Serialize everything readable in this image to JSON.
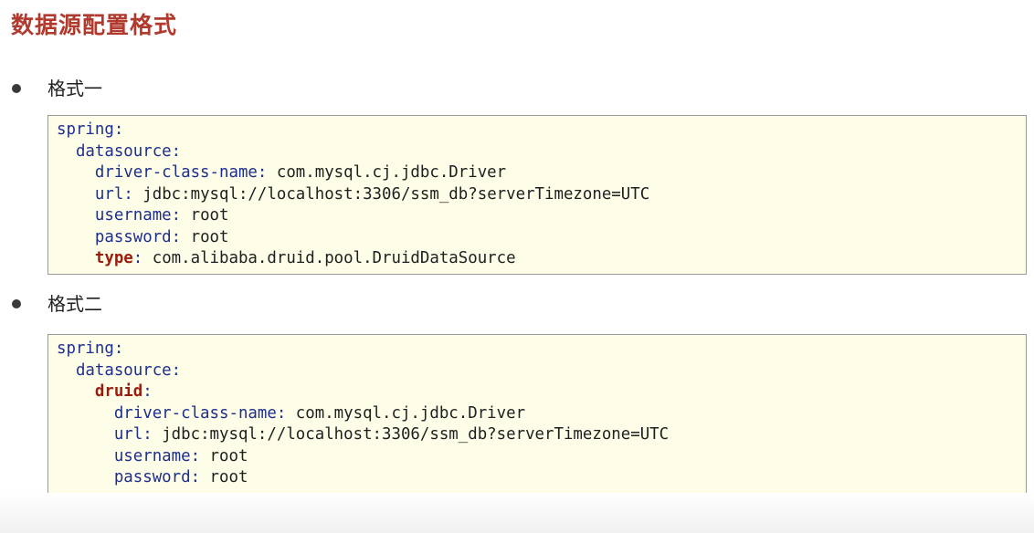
{
  "title": "数据源配置格式",
  "sections": [
    {
      "heading": "格式一",
      "lines": [
        {
          "indent": "",
          "key": "spring",
          "sep": ":",
          "value": "",
          "style": "blue"
        },
        {
          "indent": "  ",
          "key": "datasource",
          "sep": ":",
          "value": "",
          "style": "blue"
        },
        {
          "indent": "    ",
          "key": "driver-class-name",
          "sep": ":",
          "value": " com.mysql.cj.jdbc.Driver",
          "style": "blue"
        },
        {
          "indent": "    ",
          "key": "url",
          "sep": ":",
          "value": " jdbc:mysql://localhost:3306/ssm_db?serverTimezone=UTC",
          "style": "blue"
        },
        {
          "indent": "    ",
          "key": "username",
          "sep": ":",
          "value": " root",
          "style": "blue"
        },
        {
          "indent": "    ",
          "key": "password",
          "sep": ":",
          "value": " root",
          "style": "blue"
        },
        {
          "indent": "    ",
          "key": "type",
          "sep": ":",
          "value": " com.alibaba.druid.pool.DruidDataSource",
          "style": "red"
        }
      ]
    },
    {
      "heading": "格式二",
      "lines": [
        {
          "indent": "",
          "key": "spring",
          "sep": ":",
          "value": "",
          "style": "blue"
        },
        {
          "indent": "  ",
          "key": "datasource",
          "sep": ":",
          "value": "",
          "style": "blue"
        },
        {
          "indent": "    ",
          "key": "druid",
          "sep": ":",
          "value": "",
          "style": "red"
        },
        {
          "indent": "      ",
          "key": "driver-class-name",
          "sep": ":",
          "value": " com.mysql.cj.jdbc.Driver",
          "style": "blue"
        },
        {
          "indent": "      ",
          "key": "url",
          "sep": ":",
          "value": " jdbc:mysql://localhost:3306/ssm_db?serverTimezone=UTC",
          "style": "blue"
        },
        {
          "indent": "      ",
          "key": "username",
          "sep": ":",
          "value": " root",
          "style": "blue"
        },
        {
          "indent": "      ",
          "key": "password",
          "sep": ":",
          "value": " root",
          "style": "blue"
        }
      ]
    }
  ],
  "colors": {
    "title": "#b03a2e",
    "key_blue": "#1c2f8f",
    "key_red": "#9b1c0e",
    "code_bg": "#fefde8"
  }
}
